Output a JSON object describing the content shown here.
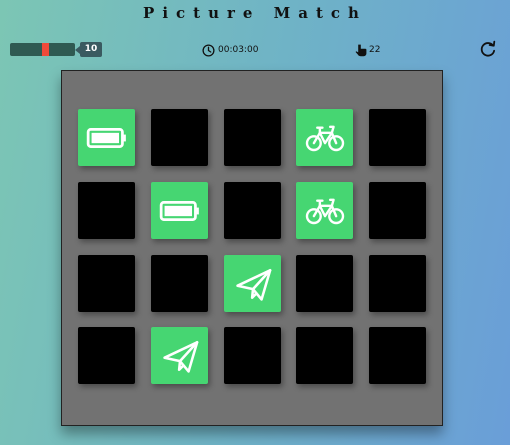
{
  "title": "Picture Match",
  "level": {
    "value": "10",
    "slider_fraction": 0.55
  },
  "timer": {
    "text": "00:03:00",
    "icon": "clock-icon"
  },
  "moves": {
    "count": "22",
    "icon": "hand-icon"
  },
  "restart": {
    "icon": "refresh-icon"
  },
  "colors": {
    "card_back": "#000000",
    "card_open": "#46d672",
    "board": "#727272",
    "slider_thumb": "#f04a3a"
  },
  "board": {
    "rows": 4,
    "cols": 5,
    "cards": [
      {
        "icon": "battery-icon",
        "open": true
      },
      {
        "icon": "",
        "open": false
      },
      {
        "icon": "",
        "open": false
      },
      {
        "icon": "bicycle-icon",
        "open": true
      },
      {
        "icon": "",
        "open": false
      },
      {
        "icon": "",
        "open": false
      },
      {
        "icon": "battery-icon",
        "open": true
      },
      {
        "icon": "",
        "open": false
      },
      {
        "icon": "bicycle-icon",
        "open": true
      },
      {
        "icon": "",
        "open": false
      },
      {
        "icon": "",
        "open": false
      },
      {
        "icon": "",
        "open": false
      },
      {
        "icon": "paper-plane-icon",
        "open": true
      },
      {
        "icon": "",
        "open": false
      },
      {
        "icon": "",
        "open": false
      },
      {
        "icon": "",
        "open": false
      },
      {
        "icon": "paper-plane-icon",
        "open": true
      },
      {
        "icon": "",
        "open": false
      },
      {
        "icon": "",
        "open": false
      },
      {
        "icon": "",
        "open": false
      }
    ]
  }
}
